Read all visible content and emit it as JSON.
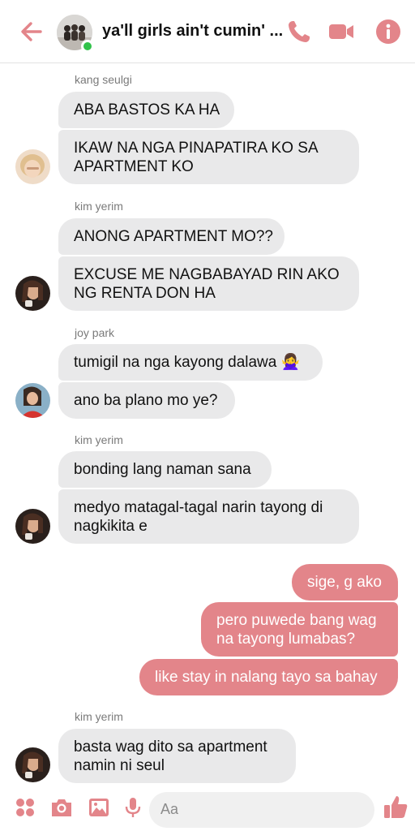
{
  "header": {
    "title": "ya'll girls ain't cumin' ...",
    "back_icon": "arrow-left-icon",
    "call_icon": "phone-icon",
    "video_icon": "video-camera-icon",
    "info_icon": "info-icon",
    "accent": "#e3858a"
  },
  "messages": [
    {
      "sender": "kang seulgi",
      "lines": [
        "ABA BASTOS KA HA",
        "IKAW NA NGA PINAPATIRA KO SA",
        "APARTMENT KO"
      ]
    },
    {
      "sender": "kim yerim",
      "lines": [
        "ANONG APARTMENT MO??",
        "EXCUSE ME NAGBABAYAD RIN AKO",
        "NG RENTA DON HA"
      ]
    },
    {
      "sender": "joy park",
      "lines": [
        "tumigil na nga kayong dalawa",
        "ano ba plano mo ye?"
      ]
    },
    {
      "sender": "kim yerim",
      "lines": [
        "bonding lang naman sana",
        "medyo matagal-tagal narin tayong di",
        "nagkikita e"
      ]
    },
    {
      "sender": "me",
      "lines": [
        "sige, g ako",
        "pero puwede bang wag",
        "na tayong lumabas?",
        "like stay in nalang tayo sa bahay"
      ]
    },
    {
      "sender": "kim yerim",
      "lines": [
        "basta wag dito sa apartment",
        "namin ni seul"
      ]
    }
  ],
  "emoji": "🙅‍♀️",
  "composer": {
    "placeholder": "Aa",
    "icons": [
      "apps-icon",
      "camera-icon",
      "image-icon",
      "microphone-icon",
      "emoji-icon",
      "thumbs-up-icon"
    ]
  }
}
